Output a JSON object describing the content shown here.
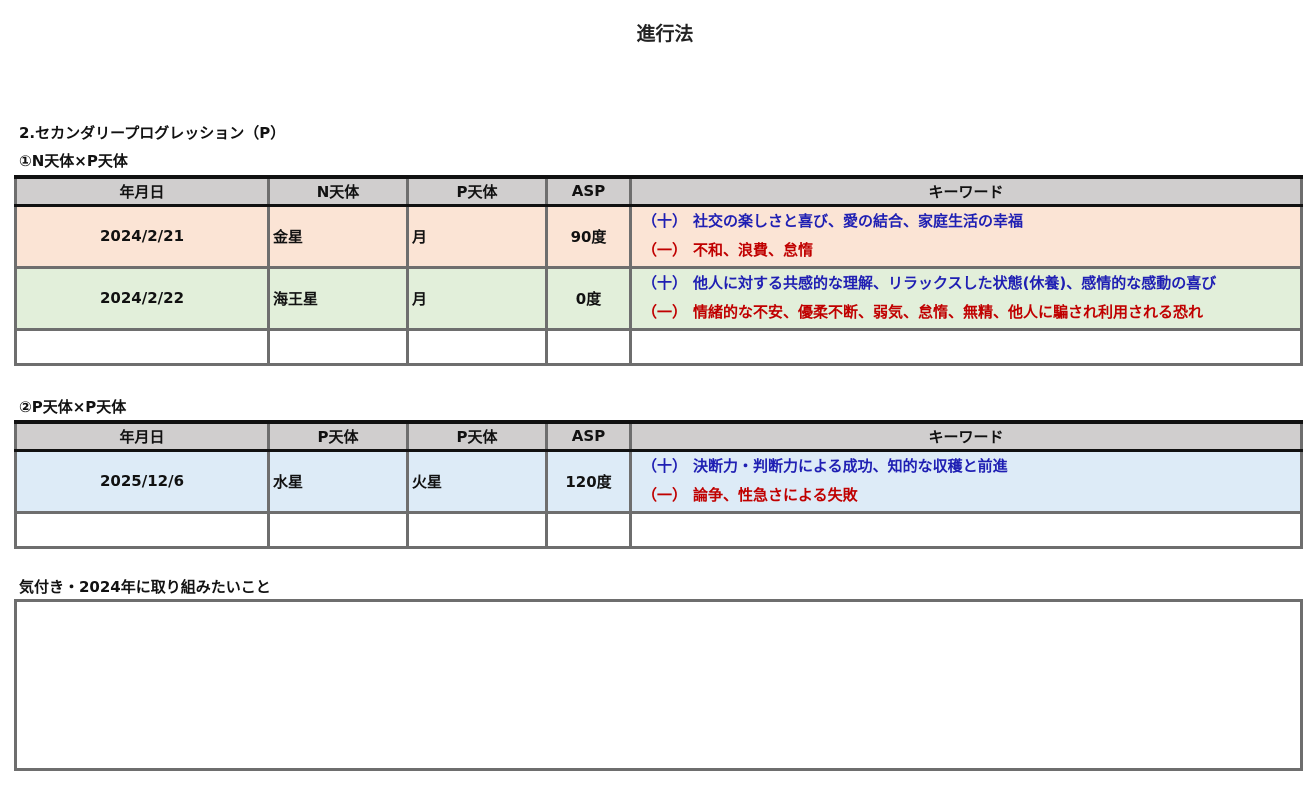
{
  "page_title": "進行法",
  "section_heading": "2.セカンダリープログレッション（P）",
  "table1": {
    "label": "①N天体×P天体",
    "headers": [
      "年月日",
      "N天体",
      "P天体",
      "ASP",
      "キーワード"
    ],
    "rows": [
      {
        "date": "2024/2/21",
        "planet_a": "金星",
        "planet_b": "月",
        "asp": "90度",
        "plus_sign": "（十）",
        "plus_text": "社交の楽しさと喜び、愛の結合、家庭生活の幸福",
        "minus_sign": "（一）",
        "minus_text": "不和、浪費、怠惰"
      },
      {
        "date": "2024/2/22",
        "planet_a": "海王星",
        "planet_b": "月",
        "asp": "0度",
        "plus_sign": "（十）",
        "plus_text": "他人に対する共感的な理解、リラックスした状態(休養)、感情的な感動の喜び",
        "minus_sign": "（一）",
        "minus_text": "情緒的な不安、優柔不断、弱気、怠惰、無精、他人に騙され利用される恐れ"
      }
    ]
  },
  "table2": {
    "label": "②P天体×P天体",
    "headers": [
      "年月日",
      "P天体",
      "P天体",
      "ASP",
      "キーワード"
    ],
    "rows": [
      {
        "date": "2025/12/6",
        "planet_a": "水星",
        "planet_b": "火星",
        "asp": "120度",
        "plus_sign": "（十）",
        "plus_text": "決断力・判断力による成功、知的な収穫と前進",
        "minus_sign": "（一）",
        "minus_text": "論争、性急さによる失敗"
      }
    ]
  },
  "notes": {
    "label": "気付き・2024年に取り組みたいこと",
    "content": ""
  },
  "colors": {
    "header_bg": "#d0cece",
    "row1_bg": "#fbe4d5",
    "row2_bg": "#e2efda",
    "row3_bg": "#ddebf7",
    "plus_text": "#1f1fb3",
    "minus_text": "#c00000"
  }
}
